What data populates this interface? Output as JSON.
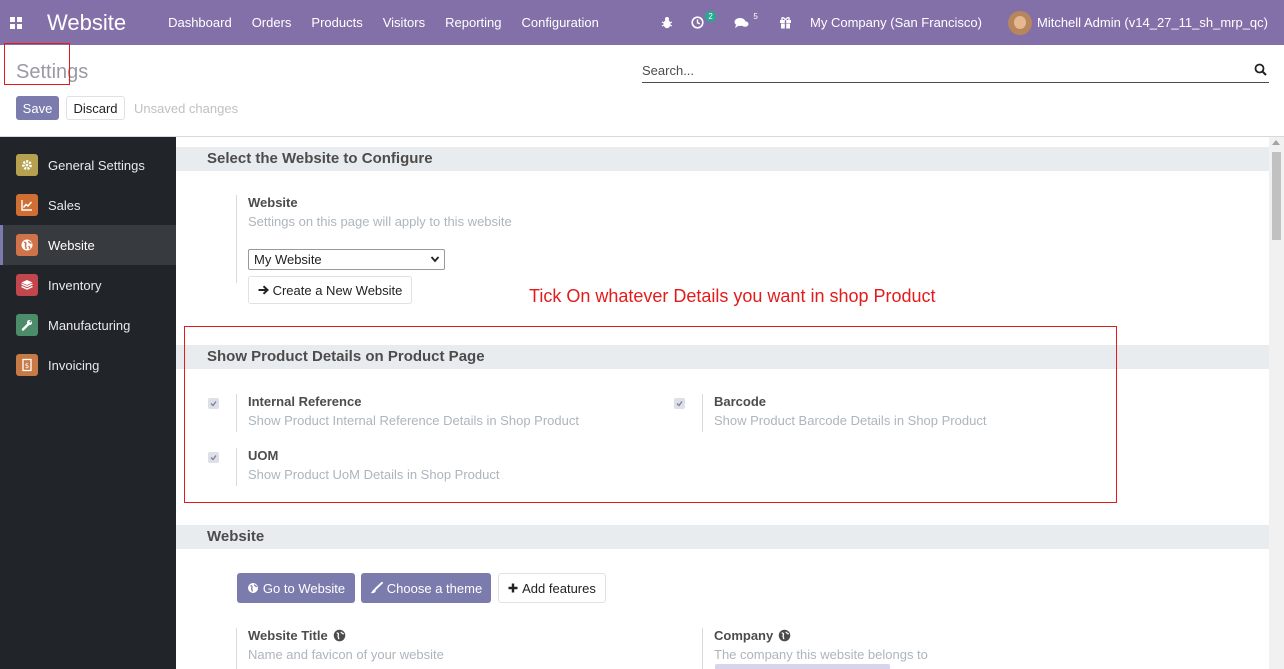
{
  "navbar": {
    "brand": "Website",
    "menu": [
      "Dashboard",
      "Orders",
      "Products",
      "Visitors",
      "Reporting",
      "Configuration"
    ],
    "activity_count": "2",
    "messages_count": "5",
    "company": "My Company (San Francisco)",
    "user": "Mitchell Admin (v14_27_11_sh_mrp_qc)",
    "color": "#8470a9"
  },
  "control_panel": {
    "title": "Settings",
    "search_placeholder": "Search...",
    "save_label": "Save",
    "discard_label": "Discard",
    "status": "Unsaved changes"
  },
  "sidebar": {
    "items": [
      {
        "label": "General Settings",
        "icon": "gear-icon",
        "color": "#b5a14f"
      },
      {
        "label": "Sales",
        "icon": "chart-icon",
        "color": "#d06f34"
      },
      {
        "label": "Website",
        "icon": "globe-icon",
        "color": "#d0734b"
      },
      {
        "label": "Inventory",
        "icon": "box-icon",
        "color": "#c2464c"
      },
      {
        "label": "Manufacturing",
        "icon": "wrench-icon",
        "color": "#4d8c6a"
      },
      {
        "label": "Invoicing",
        "icon": "invoice-icon",
        "color": "#c77a45"
      }
    ]
  },
  "sections": {
    "select_website": {
      "heading": "Select the Website to Configure",
      "field_title": "Website",
      "field_desc": "Settings on this page will apply to this website",
      "selected": "My Website",
      "create_label": "Create a New Website"
    },
    "annotation": "Tick On whatever Details you want in shop Product",
    "product_details": {
      "heading": "Show Product Details on Product Page",
      "internal_ref_title": "Internal Reference",
      "internal_ref_desc": "Show Product Internal Reference Details in Shop Product",
      "barcode_title": "Barcode",
      "barcode_desc": "Show Product Barcode Details in Shop Product",
      "uom_title": "UOM",
      "uom_desc": "Show Product UoM Details in Shop Product"
    },
    "website": {
      "heading": "Website",
      "go_label": "Go to Website",
      "theme_label": "Choose a theme",
      "features_label": "Add features",
      "title_title": "Website Title",
      "title_desc": "Name and favicon of your website",
      "company_title": "Company",
      "company_desc": "The company this website belongs to"
    }
  }
}
